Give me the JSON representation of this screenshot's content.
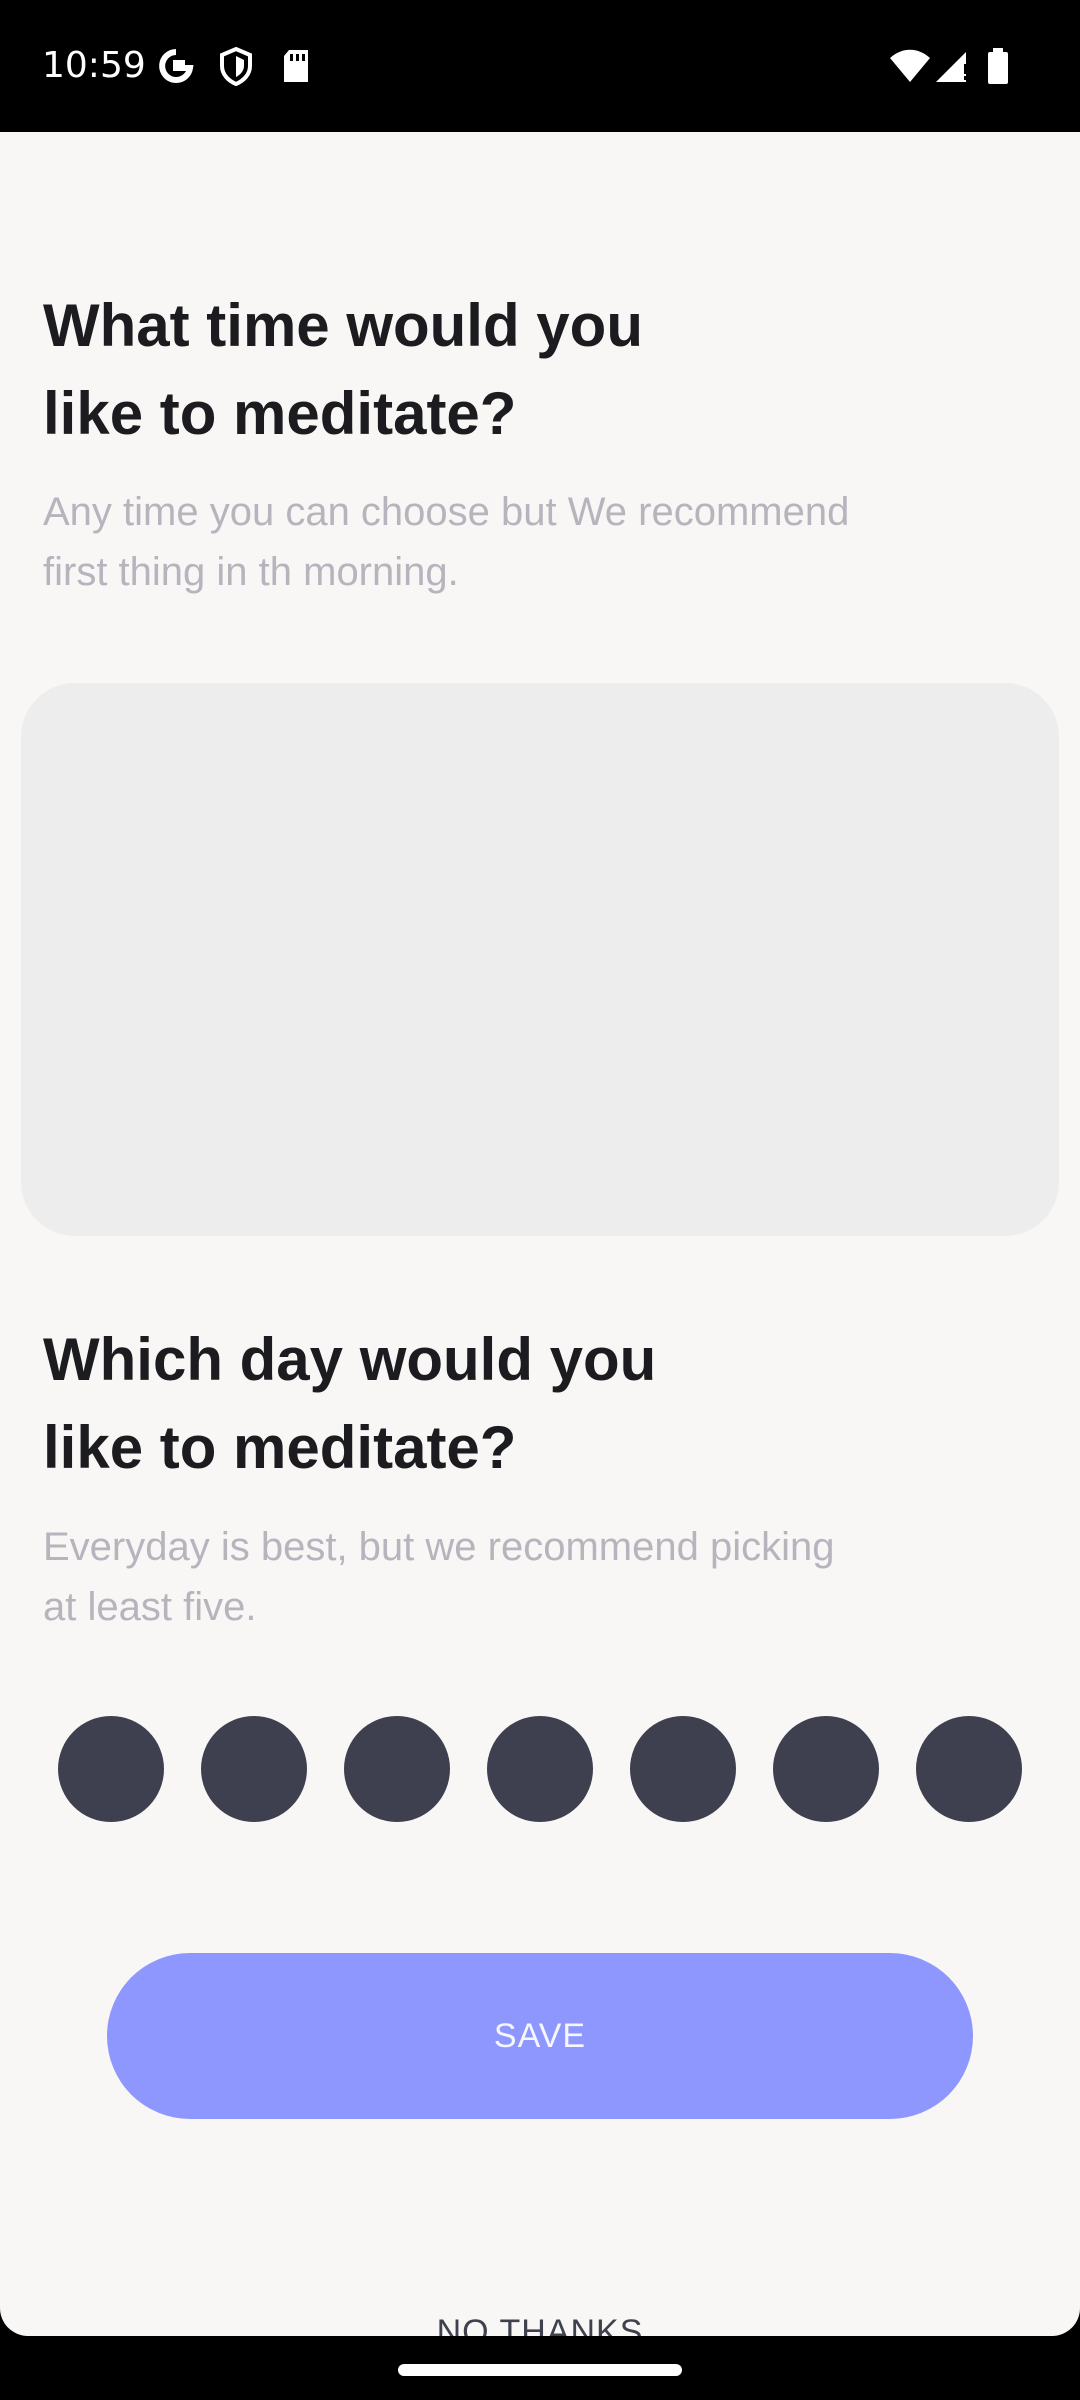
{
  "status_bar": {
    "time": "10:59",
    "left_icons": [
      "google-icon",
      "vpn-shield-icon",
      "sd-card-icon"
    ],
    "right_icons": [
      "wifi-icon",
      "cell-signal-icon",
      "battery-icon"
    ]
  },
  "time_section": {
    "title": "What time would you\nlike to meditate?",
    "subtitle": "Any time you can choose but We recommend\nfirst thing in th morning."
  },
  "day_section": {
    "title": "Which day would you\nlike to meditate?",
    "subtitle": "Everyday is best, but we recommend picking\nat least five.",
    "day_count": 7
  },
  "actions": {
    "save_label": "SAVE",
    "no_thanks_label": "NO THANKS"
  },
  "colors": {
    "background": "#f8f7f5",
    "accent": "#8e97fd",
    "day_circle": "#3f404f",
    "heading": "#1c1b1f",
    "subtext": "#b7b4bd",
    "picker_background": "#ededed"
  }
}
